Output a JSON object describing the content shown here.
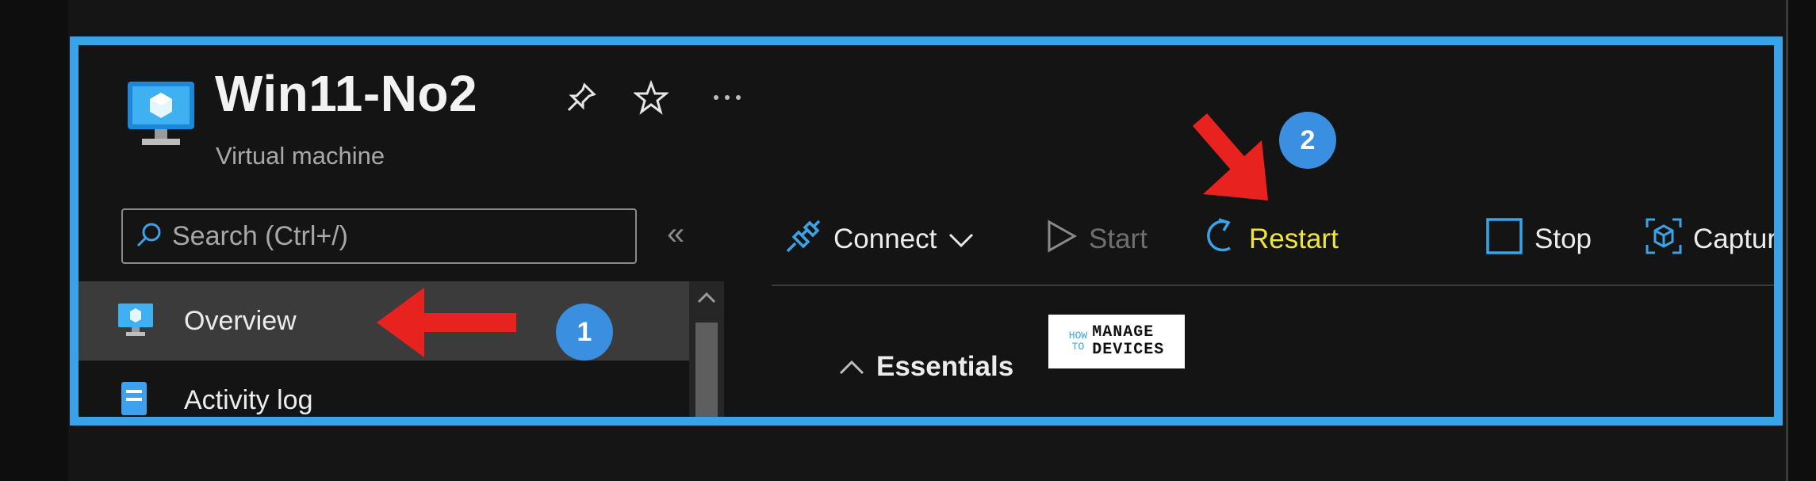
{
  "vm": {
    "title": "Win11-No2",
    "subtitle": "Virtual machine"
  },
  "search": {
    "placeholder": "Search (Ctrl+/)"
  },
  "nav": {
    "collapse_glyph": "«",
    "items": [
      {
        "label": "Overview",
        "icon": "vm-monitor-icon",
        "active": true
      },
      {
        "label": "Activity log",
        "icon": "activity-log-icon",
        "active": false
      }
    ]
  },
  "toolbar": {
    "connect": "Connect",
    "start": "Start",
    "restart": "Restart",
    "stop": "Stop",
    "capture": "Capture"
  },
  "essentials": "Essentials",
  "watermark": {
    "line1_left": "HOW",
    "line2_left": "TO",
    "line1_right": "MANAGE",
    "line2_right": "DEVICES"
  },
  "annotations": {
    "badge1": "1",
    "badge2": "2"
  },
  "colors": {
    "frame_border": "#3aa3e8",
    "badge": "#3b8fe0",
    "arrow": "#e8231f",
    "restart_highlight": "#f0e63a",
    "accent_icon": "#3aa3e8"
  }
}
